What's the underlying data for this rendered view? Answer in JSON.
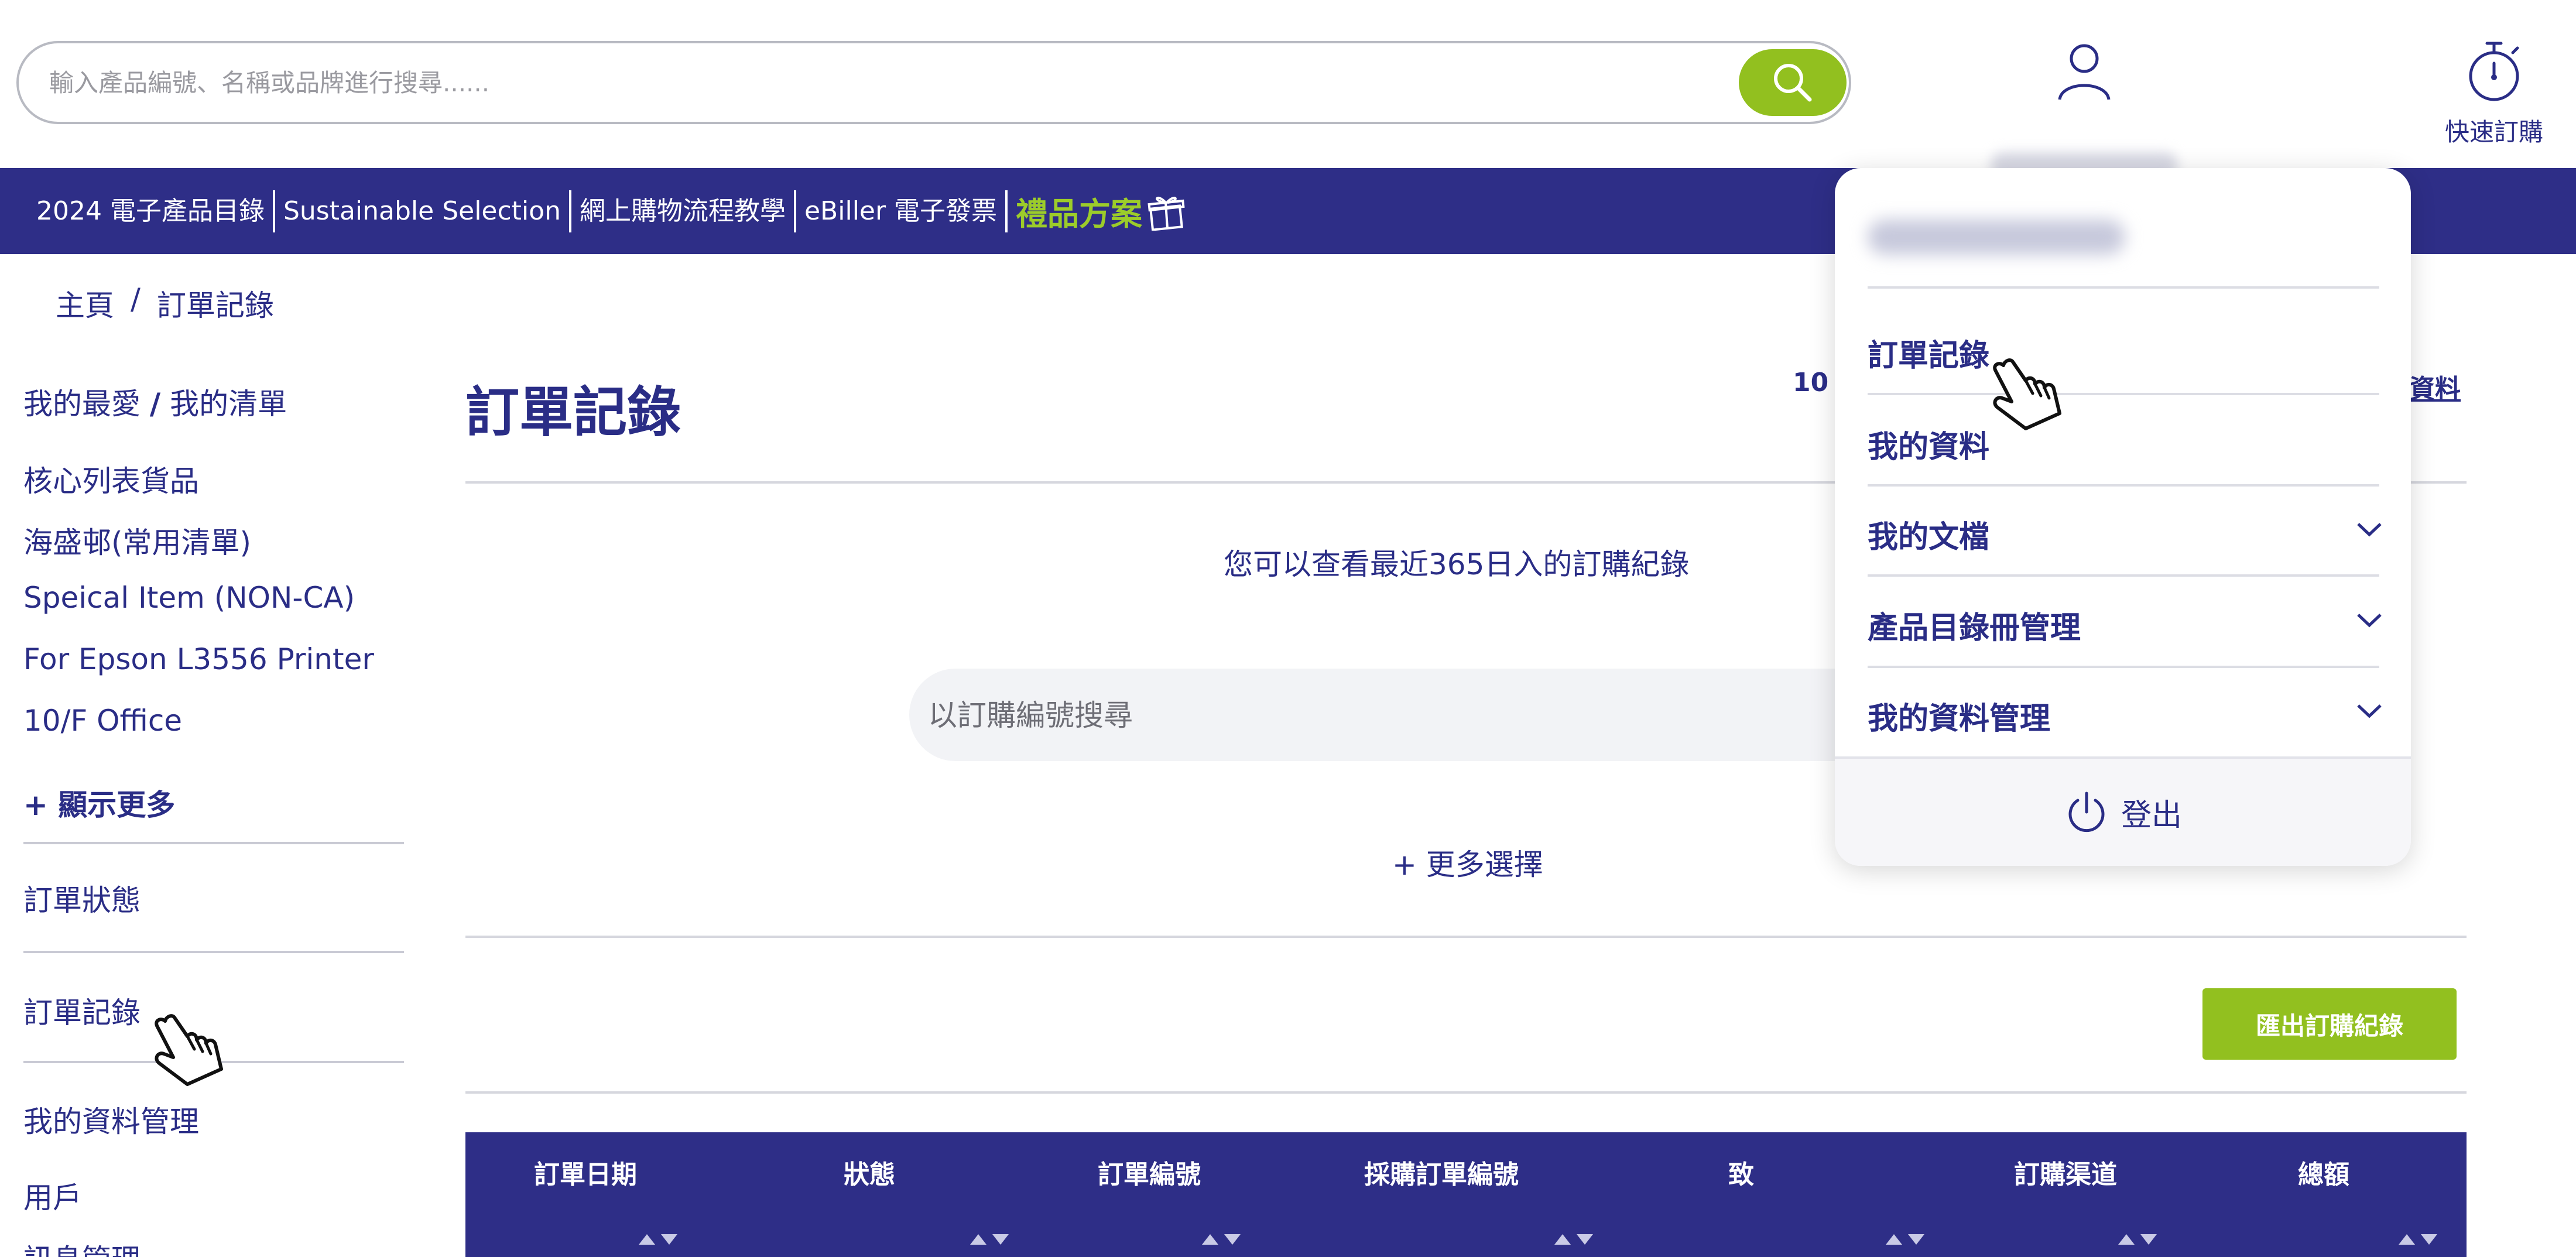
{
  "header": {
    "search_placeholder": "輸入產品編號、名稱或品牌進行搜尋......",
    "quick_order_label": "快速訂購"
  },
  "nav": {
    "links": [
      "2024 電子產品目錄",
      "Sustainable Selection",
      "網上購物流程教學",
      "eBiller 電子發票"
    ],
    "gift_label": "禮品方案"
  },
  "breadcrumb": {
    "home": "主頁",
    "separator": "/",
    "current": "訂單記錄"
  },
  "sidebar": {
    "favorites_label": "我的最愛",
    "favorites_sep": "/",
    "lists_label": "我的清單",
    "lists": [
      "核心列表貨品",
      "海盛邨(常用清單)",
      "Speical Item (NON-CA)",
      "For Epson L3556 Printer",
      "10/F Office"
    ],
    "show_more": "+ 顯示更多",
    "order_status": "訂單狀態",
    "order_history": "訂單記錄",
    "account_mgmt": "我的資料管理",
    "users": "用戶",
    "partial_item": "訊息管理"
  },
  "main": {
    "title": "訂單記錄",
    "top_info": "10",
    "top_link": "資料",
    "info_text": "您可以查看最近365日入的訂購紀錄",
    "order_search_placeholder": "以訂購編號搜尋",
    "more_options": "+ 更多選擇",
    "export_button": "匯出訂購紀錄"
  },
  "table": {
    "headers": [
      "訂單日期",
      "狀態",
      "訂單編號",
      "採購訂單編號",
      "致",
      "訂購渠道",
      "總額"
    ]
  },
  "dropdown": {
    "items": [
      "訂單記錄",
      "我的資料",
      "我的文檔",
      "產品目錄冊管理",
      "我的資料管理"
    ],
    "logout": "登出"
  },
  "colors": {
    "brand_navy": "#2e2e87",
    "accent_green": "#92c01f",
    "gift_green": "#9ccc2a"
  }
}
